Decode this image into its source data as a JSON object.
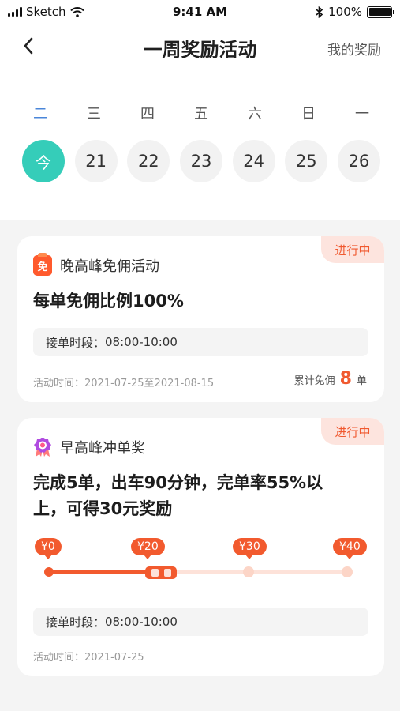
{
  "status_bar": {
    "carrier": "Sketch",
    "time": "9:41 AM",
    "battery": "100%"
  },
  "nav": {
    "title": "一周奖励活动",
    "right_label": "我的奖励",
    "back_icon": "chevron-left-icon"
  },
  "week": {
    "weekdays": [
      "二",
      "三",
      "四",
      "五",
      "六",
      "日",
      "一"
    ],
    "active_index": 0,
    "dates": [
      "今",
      "21",
      "22",
      "23",
      "24",
      "25",
      "26"
    ],
    "accent": "#35cdb9",
    "weekday_active_color": "#4a86d9"
  },
  "cards": [
    {
      "status": "进行中",
      "icon": "free-commission-icon",
      "name": "晚高峰免佣活动",
      "main": "每单免佣比例100%",
      "period_label": "接单时段：",
      "period_value": "08:00-10:00",
      "activity_time": "活动时间：2021-07-25至2021-08-15",
      "total_label": "累计免佣",
      "total_count": "8",
      "total_unit": "单"
    },
    {
      "status": "进行中",
      "icon": "award-medal-icon",
      "name": "早高峰冲单奖",
      "main_line1": "完成5单，出车90分钟，完单率55%以",
      "main_line2": "上，可得30元奖励",
      "milestones": [
        "¥0",
        "¥20",
        "¥30",
        "¥40"
      ],
      "progress_fraction": 0.33,
      "period_label": "接单时段：",
      "period_value": "08:00-10:00",
      "activity_time": "活动时间：2021-07-25"
    }
  ],
  "colors": {
    "brand_orange": "#f25a2e",
    "badge_bg": "#fde4de"
  }
}
